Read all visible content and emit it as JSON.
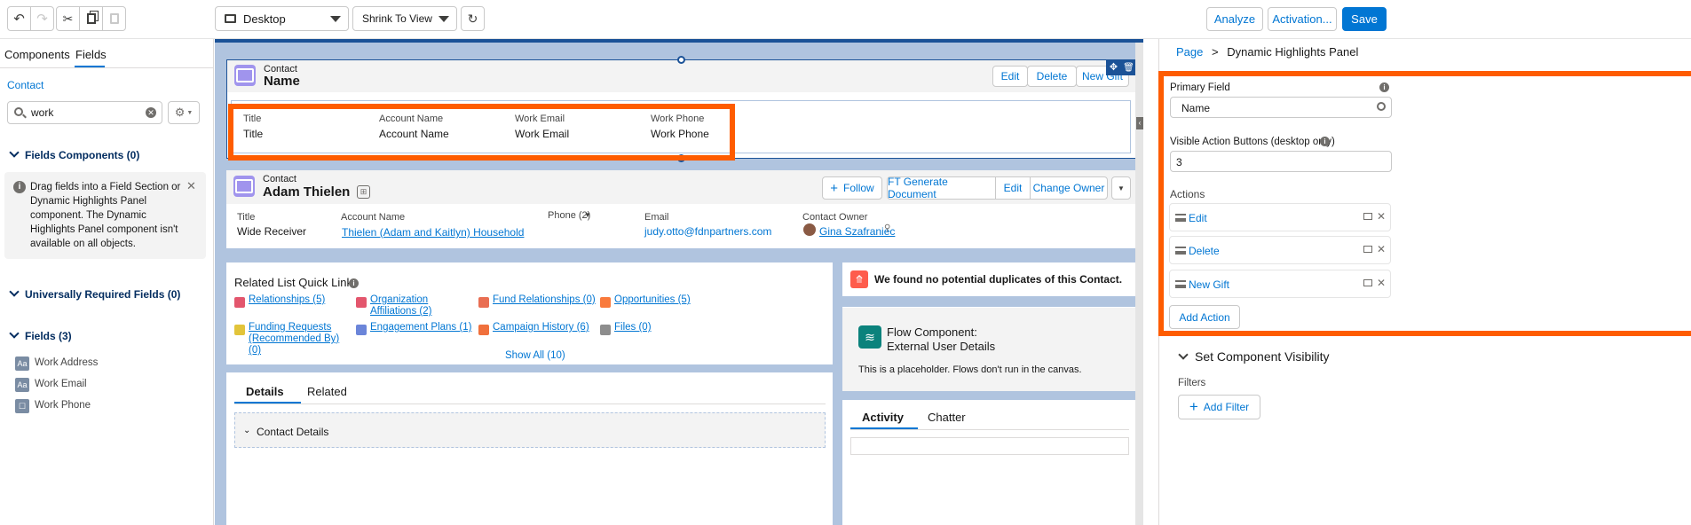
{
  "toolbar": {
    "device_select": "Desktop",
    "zoom_select": "Shrink To View",
    "analyze_label": "Analyze",
    "activation_label": "Activation...",
    "save_label": "Save"
  },
  "left_panel": {
    "tabs": [
      "Components",
      "Fields"
    ],
    "active_tab": "Fields",
    "object_link": "Contact",
    "search_value": "work",
    "fields_components_title": "Fields Components (0)",
    "info_text": "Drag fields into a Field Section or Dynamic Highlights Panel component. The Dynamic Highlights Panel component isn't available on all objects.",
    "universally_required_title": "Universally Required Fields (0)",
    "fields_title": "Fields (3)",
    "fields": [
      {
        "icon": "text-field-icon",
        "label": "Work Address"
      },
      {
        "icon": "text-field-icon",
        "label": "Work Email"
      },
      {
        "icon": "phone-field-icon",
        "label": "Work Phone"
      }
    ]
  },
  "canvas": {
    "dhp": {
      "object_label": "Contact",
      "name": "Name",
      "actions": [
        "Edit",
        "Delete",
        "New Gift"
      ],
      "fields": [
        {
          "label": "Title",
          "value": "Title"
        },
        {
          "label": "Account Name",
          "value": "Account Name"
        },
        {
          "label": "Work Email",
          "value": "Work Email"
        },
        {
          "label": "Work Phone",
          "value": "Work Phone"
        }
      ]
    },
    "record": {
      "object_label": "Contact",
      "name": "Adam Thielen",
      "follow_label": "Follow",
      "actions": [
        "FT Generate Document",
        "Edit",
        "Change Owner"
      ],
      "fields": {
        "title_label": "Title",
        "title_value": "Wide Receiver",
        "account_label": "Account Name",
        "account_value": "Thielen (Adam and Kaitlyn) Household",
        "phone_label": "Phone (2)",
        "email_label": "Email",
        "email_value": "judy.otto@fdnpartners.com",
        "owner_label": "Contact Owner",
        "owner_value": "Gina Szafraniec"
      }
    },
    "quick_links": {
      "title": "Related List Quick Links",
      "items": [
        {
          "label": "Relationships (5)",
          "color": "#e3566d"
        },
        {
          "label": "Organization Affiliations (2)",
          "color": "#e3566d"
        },
        {
          "label": "Fund Relationships (0)",
          "color": "#e96e52"
        },
        {
          "label": "Opportunities (5)",
          "color": "#f97a3c"
        },
        {
          "label": "Funding Requests (Recommended By) (0)",
          "color": "#e2c43a"
        },
        {
          "label": "Engagement Plans (1)",
          "color": "#6b85d9"
        },
        {
          "label": "Campaign History (6)",
          "color": "#f0703c"
        },
        {
          "label": "Files (0)",
          "color": "#8d8d8d"
        }
      ],
      "show_all": "Show All (10)"
    },
    "detail_tabs": [
      "Details",
      "Related"
    ],
    "contact_details_label": "Contact Details",
    "duplicates_text": "We found no potential duplicates of this Contact.",
    "flow": {
      "title_line1": "Flow Component:",
      "title_line2": "External User Details",
      "placeholder": "This is a placeholder. Flows don't run in the canvas."
    },
    "activity_tabs": [
      "Activity",
      "Chatter"
    ]
  },
  "right_panel": {
    "breadcrumb_page": "Page",
    "breadcrumb_sep": ">",
    "breadcrumb_current": "Dynamic Highlights Panel",
    "primary_field_label": "Primary Field",
    "primary_field_value": "Name",
    "visible_actions_label": "Visible Action Buttons (desktop only)",
    "visible_actions_value": "3",
    "actions_label": "Actions",
    "actions": [
      "Edit",
      "Delete",
      "New Gift"
    ],
    "add_action_label": "Add Action",
    "visibility_title": "Set Component Visibility",
    "filters_label": "Filters",
    "add_filter_label": "Add Filter"
  },
  "colors": {
    "accent": "#0176d3",
    "highlight": "#fe5c00",
    "canvas_bg": "#b0c4df",
    "contact_icon": "#a094ed"
  }
}
